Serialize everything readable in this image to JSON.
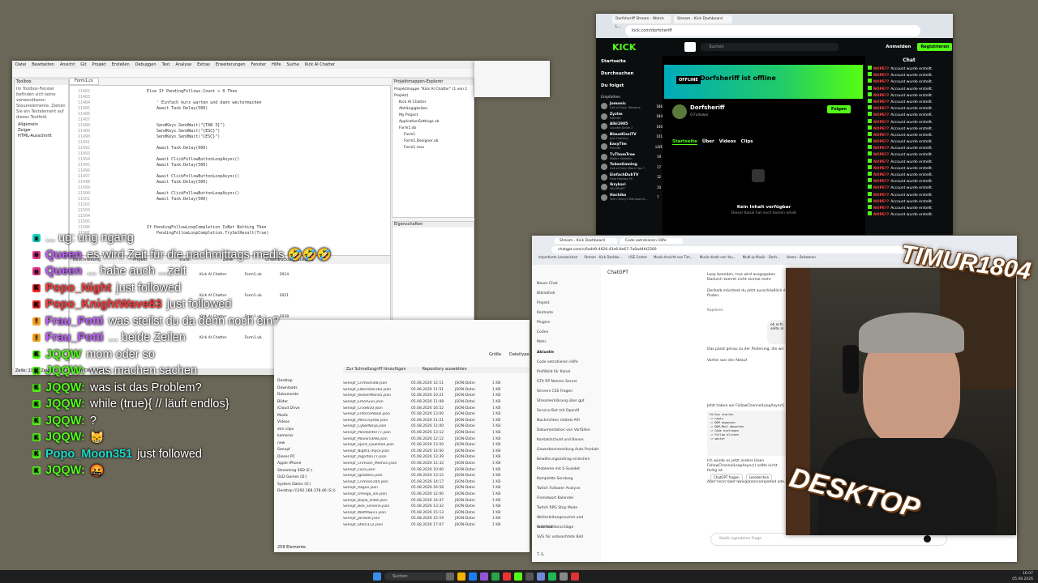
{
  "vs": {
    "menu": [
      "Datei",
      "Bearbeiten",
      "Ansicht",
      "Git",
      "Projekt",
      "Erstellen",
      "Debuggen",
      "Test",
      "Analyse",
      "Extras",
      "Erweiterungen",
      "Fenster",
      "Hilfe",
      "Suche",
      "Kick AI Chatter"
    ],
    "tab_active": "Form1.cs",
    "solution_title": "Projektmappen-Explorer",
    "solution_items": [
      "Projektmappe \"Kick AI Chatter\" (1 von 1 Projekt)",
      "Kick AI Chatter",
      "Abhängigkeiten",
      "My Project",
      "AppIcationSettings.vb",
      "Form1.vb",
      "Form1",
      "Form1.Designer.vb",
      "Form1.resx"
    ],
    "props_title": "Eigenschaften",
    "code_lines": [
      "Else If PendingFollows.Count > 0 Then",
      "",
      "    ' Einfach kurz warten und dann weitermachen",
      "    Await Task.Delay(500)",
      "",
      "",
      "    SendKeys.SendWait(\"{TAB 3}\")",
      "    SendKeys.SendWait(\"{ESC}\")",
      "    SendKeys.SendWait(\"{ESC}\")",
      "",
      "    Await Task.Delay(600)",
      "",
      "    Await ClickFollowButtonLoopAsync()",
      "    Await Task.Delay(500)",
      "",
      "    Await ClickFollowButtonLoopAsync()",
      "    Await Task.Delay(500)",
      "",
      "    Await ClickFollowButtonLoopAsync()",
      "    Await Task.Delay(500)",
      "",
      "",
      "",
      "",
      "If PendingFollowLoopCompletion IsNot Nothing Then",
      "    PendingFollowLoopCompletion.TrySetResult(True)"
    ],
    "line_start": "11482",
    "status_text": "Zeile: 1385, Zeichen: 57   Zeichen   CRLF   Bereit",
    "left_panel_title": "Toolbox",
    "left_panel_text": "Im Toolbox-Fenster befinden sich keine verwendbaren Steuerelemente. Ziehen Sie ein Textelement auf dieses Textfeld.",
    "left_tree": [
      "Allgemein",
      "Zeiger",
      "HTML-Ausschnitt"
    ],
    "err_headers": [
      "Beschreibung",
      "Projekt",
      "Datei",
      "Zeile",
      "Unterdrückungszustand"
    ],
    "err_rows": [
      [
        "Kick AI Chatter",
        "Form1.vb",
        "2014"
      ],
      [
        "Kick AI Chatter",
        "Form1.vb",
        "2021"
      ],
      [
        "Kick AI Chatter",
        "Form1.vb",
        "2028"
      ],
      [
        "Kick AI Chatter",
        "Form1.vb",
        "4014"
      ]
    ]
  },
  "explorer": {
    "toolbar_left": "Zur Schnellzugriff hinzufügen",
    "toolbar_right": "Repository auswählen",
    "col_size": "Größe",
    "col_type": "Dateitypen",
    "nav": [
      "Desktop",
      "Downloads",
      "Dokumente",
      "Bilder",
      "iCloud Drive",
      "Musik",
      "Videos",
      "stm clips",
      "kameras",
      "new",
      "Sennpf",
      "Dieser PC",
      "Apple iPhone",
      "Streaming SSD (E:)",
      "OLD Games (D:)",
      "System Daten (S:)",
      "Desktop (\\\\192.168.178.46 (S:))"
    ],
    "files": [
      [
        "Sennpf_Crimsoni48.json",
        "05.08.2026 12:11",
        "JSON-Datei",
        "1 KB"
      ],
      [
        "Sennpf_Elbernbar283.json",
        "05.08.2026 11:51",
        "JSON-Datei",
        "1 KB"
      ],
      [
        "Sennpf_ReckerMan45.json",
        "05.08.2026 10:21",
        "JSON-Datei",
        "1 KB"
      ],
      [
        "Sennpf_EmorGun.json",
        "05.08.2026 11:08",
        "JSON-Datei",
        "1 KB"
      ],
      [
        "Sennpf_Crixe650.json",
        "05.08.2026 16:52",
        "JSON-Datei",
        "1 KB"
      ],
      [
        "Sennpf_EnforceAbsol.json",
        "05.08.2026 13:00",
        "JSON-Datei",
        "1 KB"
      ],
      [
        "Sennpf_Mercurystar.json",
        "05.08.2026 11:21",
        "JSON-Datei",
        "1 KB"
      ],
      [
        "Sennpf_CyberNinja.json",
        "05.08.2026 11:00",
        "JSON-Datei",
        "1 KB"
      ],
      [
        "Sennpf_PandaInter77.json",
        "05.08.2026 13:12",
        "JSON-Datei",
        "1 KB"
      ],
      [
        "Sennpf_Maverick98.json",
        "05.08.2026 12:12",
        "JSON-Datei",
        "1 KB"
      ],
      [
        "Sennpf_Spirit_Qualition.json",
        "05.08.2026 13:50",
        "JSON-Datei",
        "1 KB"
      ],
      [
        "Sennpf_Night17Ryce.json",
        "05.08.2026 14:00",
        "JSON-Datei",
        "1 KB"
      ],
      [
        "Sennpf_Vigorton77.json",
        "05.08.2026 13:39",
        "JSON-Datei",
        "1 KB"
      ],
      [
        "Sennpf_Crimson_Memori.json",
        "05.08.2026 11:32",
        "JSON-Datei",
        "1 KB"
      ],
      [
        "Sennpf_Luna.json",
        "05.08.2026 10:00",
        "JSON-Datei",
        "1 KB"
      ],
      [
        "Sennpf_Ignatek5.json",
        "05.08.2026 13:15",
        "JSON-Datei",
        "1 KB"
      ],
      [
        "Sennpf_Crimson104.json",
        "05.08.2026 14:17",
        "JSON-Datei",
        "1 KB"
      ],
      [
        "Sennpf_Ragun.json",
        "05.08.2026 16:58",
        "JSON-Datei",
        "1 KB"
      ],
      [
        "Sennpf_Omega_ion.json",
        "05.08.2026 12:00",
        "JSON-Datei",
        "1 KB"
      ],
      [
        "Sennpf_Baylo_Orbit.json",
        "05.08.2026 14:47",
        "JSON-Datei",
        "1 KB"
      ],
      [
        "Sennpf_Bee_Scheine.json",
        "05.08.2026 13:32",
        "JSON-Datei",
        "1 KB"
      ],
      [
        "Sennpf_WolfPaw21.json",
        "05.08.2026 15:13",
        "JSON-Datei",
        "1 KB"
      ],
      [
        "Sennpf_Jardixer.json",
        "05.08.2026 15:19",
        "JSON-Datei",
        "1 KB"
      ],
      [
        "Sennpf_Stern112.json",
        "05.08.2026 17:07",
        "JSON-Datei",
        "1 KB"
      ]
    ],
    "status": "259 Elemente"
  },
  "kick": {
    "tabs": [
      "Dorfsheriff Stream - Watch L...",
      "Stream - Kick Dashboard"
    ],
    "url": "kick.com/dorfsheriff",
    "search_placeholder": "Suchen",
    "login": "Anmelden",
    "register": "Registrieren",
    "nav": [
      "Startseite",
      "Durchsuchen",
      "Du folgst"
    ],
    "recommended_title": "Empfohlen",
    "recommended": [
      {
        "name": "Jomonic",
        "game": "Call of Duty: Warzone",
        "viewers": "186"
      },
      {
        "name": "Zyztm",
        "game": "Fortnite",
        "viewers": "184"
      },
      {
        "name": "Albi1985",
        "game": "Counter-Strike 2",
        "viewers": "140"
      },
      {
        "name": "BlaueKissiTV",
        "game": "Just Chatting",
        "viewers": "101"
      },
      {
        "name": "EasyTim",
        "game": "Fortnite",
        "viewers": "LIVE"
      },
      {
        "name": "TvThomTree",
        "game": "Mobile Skeleton",
        "viewers": "19"
      },
      {
        "name": "TobasGaming",
        "game": "Call of Duty: Black Ops 7",
        "viewers": "17"
      },
      {
        "name": "EinfachDuhTV",
        "game": "Final Fantasy VII",
        "viewers": "12"
      },
      {
        "name": "Ikrykari",
        "game": "VALORANT",
        "viewers": "10"
      },
      {
        "name": "Hachiko",
        "game": "Tom Clancy's Rainbow Si...",
        "viewers": "7"
      }
    ],
    "offline_badge": "OFFLINE",
    "offline_text": "Dorfsheriff ist offline",
    "channel_name": "Dorfsheriff",
    "followers": "0 Follower",
    "follow": "Folgen",
    "channel_tabs": [
      "Startseite",
      "Über",
      "Videos",
      "Clips"
    ],
    "empty_title": "Kein Inhalt verfügbar",
    "empty_sub": "Dieser Kanal hat noch keinen Inhalt",
    "chat_title": "Chat",
    "chat_name": "NOPE??",
    "chat_msg": "Account wurde erstellt."
  },
  "gpt": {
    "tabs": [
      "Stream - Kick Dashboard",
      "Code extrahieren Hilfe"
    ],
    "url": "chatgpt.com/c/6a4d9-4626-43e6-8e67-7a0a44fd2300",
    "bookmarks": [
      "Importierte Lesezeichen",
      "Stream - Kick Dashbo...",
      "USE Center",
      "Musik-Ansicht von Tim...",
      "Musik direkt von You...",
      "Multi-/p-Musik - Dorfs...",
      "Home - Reitwaren"
    ],
    "brand": "ChatGPT",
    "side_top": [
      "Neuer Chat",
      "Bibliothek",
      "Projekt",
      "Kontexte",
      "Plugins",
      "Codex",
      "Mehr"
    ],
    "recent_title": "Aktuelle",
    "recent": [
      "Code extrahieren Hilfe",
      "Profilbild für Kanal",
      "GTA RP Namen Server",
      "Servers CSS Fragen",
      "Streamerklärung über gpt",
      "Service Bot mit OpenAI",
      "Nachrichten mittels API",
      "Dokumentation von Vorfällen",
      "Kontaktschuld und Banen",
      "Gewerbeanmeldung Auto Produkt",
      "Bewährungsantrag erreichen",
      "Probleme mit E-Suiedet",
      "Komplette Sendung",
      "Twitch Follower Analyse",
      "Fremdwort Kalender",
      "Twitch RPG Stop Mode",
      "Weiterleitungssuchst und Unterhalt",
      "Schilfeld Vorschläge",
      "SVG für unbeachtete Bild"
    ],
    "model_tag": "ChatGPT",
    "paragraphs": [
      "Loop beenden, true wird ausgegeben",
      "Dadurch kommt nicht einmal mehr",
      "Deshalb möchtest du jetzt ausschließlich die",
      "finden.",
      "Das passt genau zu der Änderung, die wir",
      "Vorher war der Ablauf",
      "Jetzt haben wir FollowChannelLoopAsync()",
      "Dadurch wartet Button_Click nicht mehr",
      "Sekunden. Während dessen läuft",
      "schon den nächsten Account.",
      "Ich würde es jetzt anders lösen",
      "FollowChannelLoopAsync() sollte nicht",
      "fertig ist.",
      "Aber nicht über NavigationCompleted ode..."
    ],
    "code_block": [
      "Follow starten",
      "-> Login",
      "-> DOM anpassen",
      "-> DOM-Mail abwarten",
      "-> Code eintragen",
      "-> Follow klicken",
      "-> weiter"
    ],
    "mini_btns": [
      "ChatGPT fragen",
      "Lesezeichen"
    ],
    "bubble": "ok schi\nseite al",
    "copy": "Kopieren",
    "user": "T. S.",
    "input_placeholder": "Stelle irgendeine Frage"
  },
  "sticker_top": "TIMUR1804",
  "sticker_bottom": "DESKTOP",
  "chat_overlay": [
    {
      "badge": "x",
      "badge_color": "#1ad9c8",
      "name": "",
      "name_color": "#ffffff",
      "msg": "... ug: ung ngang"
    },
    {
      "badge": "o",
      "badge_color": "#e53b8a",
      "name": "Queen",
      "name_color": "#c25cff",
      "msg": "es wird Zeit für die nachmittags medis 🤣🤣🤣"
    },
    {
      "badge": "o",
      "badge_color": "#e53b8a",
      "name": "Queen",
      "name_color": "#c25cff",
      "msg": "... habe auch ...zeit"
    },
    {
      "badge": "K",
      "badge_color": "#ff2a2a",
      "name": "Popo_Night",
      "name_color": "#ff3b3b",
      "msg": "just followed"
    },
    {
      "badge": "K",
      "badge_color": "#ff2a2a",
      "name": "Popo_KnightWave83",
      "name_color": "#ff3b3b",
      "msg": "just followed"
    },
    {
      "badge": "!",
      "badge_color": "#f5a623",
      "name": "Frau_Potti",
      "name_color": "#c25cff",
      "msg": "was steilst du da denn noch ein?"
    },
    {
      "badge": "!",
      "badge_color": "#f5a623",
      "name": "Frau_Potti",
      "name_color": "#c25cff",
      "msg": "... beide Zeilen"
    },
    {
      "badge": "K",
      "badge_color": "#53fc18",
      "name": "JQQW",
      "name_color": "#53fc18",
      "msg": "mom oder so"
    },
    {
      "badge": "K",
      "badge_color": "#53fc18",
      "name": "JQQW:",
      "name_color": "#53fc18",
      "msg": "was machen sachen"
    },
    {
      "badge": "K",
      "badge_color": "#53fc18",
      "name": "JQQW:",
      "name_color": "#53fc18",
      "msg": "was ist das Problem?"
    },
    {
      "badge": "K",
      "badge_color": "#53fc18",
      "name": "JQQW:",
      "name_color": "#53fc18",
      "msg": "while (true){ // läuft endlos}"
    },
    {
      "badge": "K",
      "badge_color": "#53fc18",
      "name": "JQQW:",
      "name_color": "#53fc18",
      "msg": "?"
    },
    {
      "badge": "K",
      "badge_color": "#53fc18",
      "name": "JQQW:",
      "name_color": "#53fc18",
      "msg": "😸"
    },
    {
      "badge": "K",
      "badge_color": "#53fc18",
      "name": "Popo_Moon351",
      "name_color": "#1ad9c8",
      "msg": "just followed"
    },
    {
      "badge": "K",
      "badge_color": "#53fc18",
      "name": "JQQW:",
      "name_color": "#53fc18",
      "msg": "🤬"
    }
  ],
  "taskbar": {
    "search": "Suchen",
    "time": "16:07",
    "date": "05.08.2026"
  },
  "colors": {
    "kick_green": "#53fc18",
    "desktop_bg": "#6b6758"
  }
}
